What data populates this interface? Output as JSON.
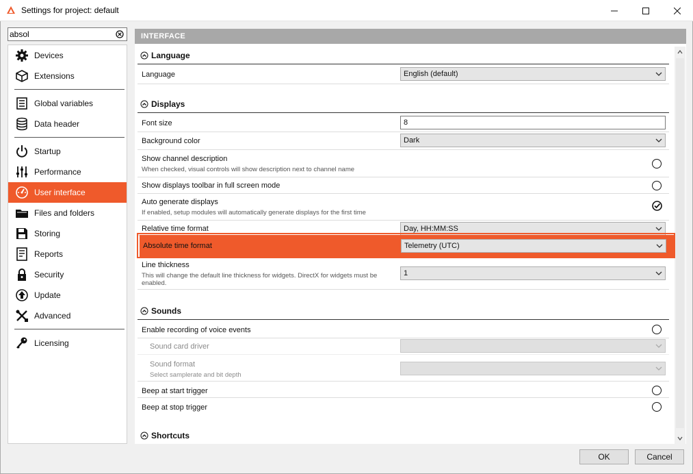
{
  "window": {
    "title": "Settings for project: default",
    "accent_color": "#ef5a2b"
  },
  "search": {
    "value": "absol"
  },
  "sidebar": {
    "items": [
      {
        "label": "Devices",
        "icon": "gear-icon"
      },
      {
        "label": "Extensions",
        "icon": "cube-icon"
      },
      {
        "label": "Global variables",
        "icon": "document-list-icon"
      },
      {
        "label": "Data header",
        "icon": "database-icon"
      },
      {
        "label": "Startup",
        "icon": "power-icon"
      },
      {
        "label": "Performance",
        "icon": "sliders-icon"
      },
      {
        "label": "User interface",
        "icon": "gauge-icon",
        "active": true
      },
      {
        "label": "Files and folders",
        "icon": "folder-icon"
      },
      {
        "label": "Storing",
        "icon": "floppy-disk-icon"
      },
      {
        "label": "Reports",
        "icon": "report-icon"
      },
      {
        "label": "Security",
        "icon": "lock-icon"
      },
      {
        "label": "Update",
        "icon": "update-arrow-icon"
      },
      {
        "label": "Advanced",
        "icon": "tools-icon"
      },
      {
        "label": "Licensing",
        "icon": "key-icon"
      }
    ]
  },
  "main": {
    "header": "INTERFACE",
    "sections": {
      "language": {
        "title": "Language",
        "rows": {
          "language": {
            "label": "Language",
            "value": "English (default)"
          }
        }
      },
      "displays": {
        "title": "Displays",
        "rows": {
          "font_size": {
            "label": "Font size",
            "value": "8"
          },
          "background_color": {
            "label": "Background color",
            "value": "Dark"
          },
          "show_channel_description": {
            "label": "Show channel description",
            "sub": "When checked, visual controls will show description next to channel name",
            "checked": false
          },
          "show_toolbar_fullscreen": {
            "label": "Show displays toolbar in full screen mode",
            "checked": false
          },
          "auto_generate": {
            "label": "Auto generate displays",
            "sub": "If enabled, setup modules will automatically generate displays for the first time",
            "checked": true
          },
          "relative_time": {
            "label": "Relative time format",
            "value": "Day, HH:MM:SS"
          },
          "absolute_time": {
            "label": "Absolute time format",
            "value": "Telemetry (UTC)",
            "highlighted": true
          },
          "line_thickness": {
            "label": "Line thickness",
            "sub": "This will change the default line thickness for widgets. DirectX for widgets must be enabled.",
            "value": "1"
          }
        }
      },
      "sounds": {
        "title": "Sounds",
        "rows": {
          "enable_voice": {
            "label": "Enable recording of voice events",
            "checked": false
          },
          "sound_card": {
            "label": "Sound card driver",
            "value": "",
            "disabled": true
          },
          "sound_format": {
            "label": "Sound format",
            "sub": "Select samplerate and bit depth",
            "value": "",
            "disabled": true
          },
          "beep_start": {
            "label": "Beep at start trigger",
            "checked": false
          },
          "beep_stop": {
            "label": "Beep at stop trigger",
            "checked": false
          }
        }
      },
      "shortcuts": {
        "title": "Shortcuts"
      }
    }
  },
  "buttons": {
    "ok": "OK",
    "cancel": "Cancel"
  }
}
